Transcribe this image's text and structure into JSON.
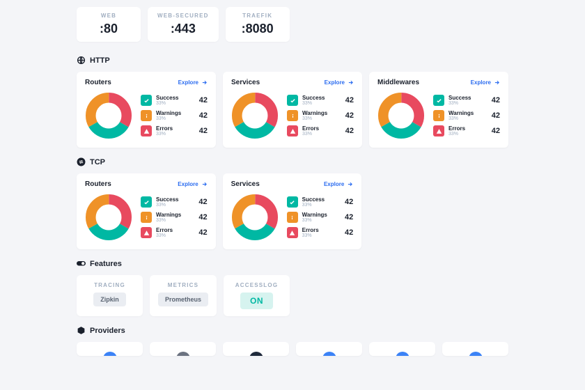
{
  "ports": [
    {
      "name": "WEB",
      "value": ":80"
    },
    {
      "name": "WEB-SECURED",
      "value": ":443"
    },
    {
      "name": "TRAEFIK",
      "value": ":8080"
    }
  ],
  "sections": {
    "http": {
      "title": "HTTP",
      "cards": [
        "Routers",
        "Services",
        "Middlewares"
      ]
    },
    "tcp": {
      "title": "TCP",
      "cards": [
        "Routers",
        "Services"
      ]
    }
  },
  "explore_label": "Explore",
  "stat_labels": {
    "success": "Success",
    "warnings": "Warnings",
    "errors": "Errors"
  },
  "pct": "33%",
  "count": "42",
  "features": {
    "title": "Features",
    "items": [
      {
        "name": "TRACING",
        "chip": "Zipkin",
        "on": false
      },
      {
        "name": "METRICS",
        "chip": "Prometheus",
        "on": false
      },
      {
        "name": "ACCESSLOG",
        "chip": "ON",
        "on": true
      }
    ]
  },
  "providers": {
    "title": "Providers",
    "colors": [
      "#3b82f6",
      "#6b7280",
      "#1e293b",
      "#3b82f6",
      "#3b82f6",
      "#3b82f6"
    ]
  },
  "chart_data": {
    "type": "pie",
    "categories": [
      "Success",
      "Warnings",
      "Errors"
    ],
    "values": [
      33,
      33,
      33
    ],
    "colors": [
      "#00b8a3",
      "#ef9228",
      "#e84a5f"
    ]
  }
}
